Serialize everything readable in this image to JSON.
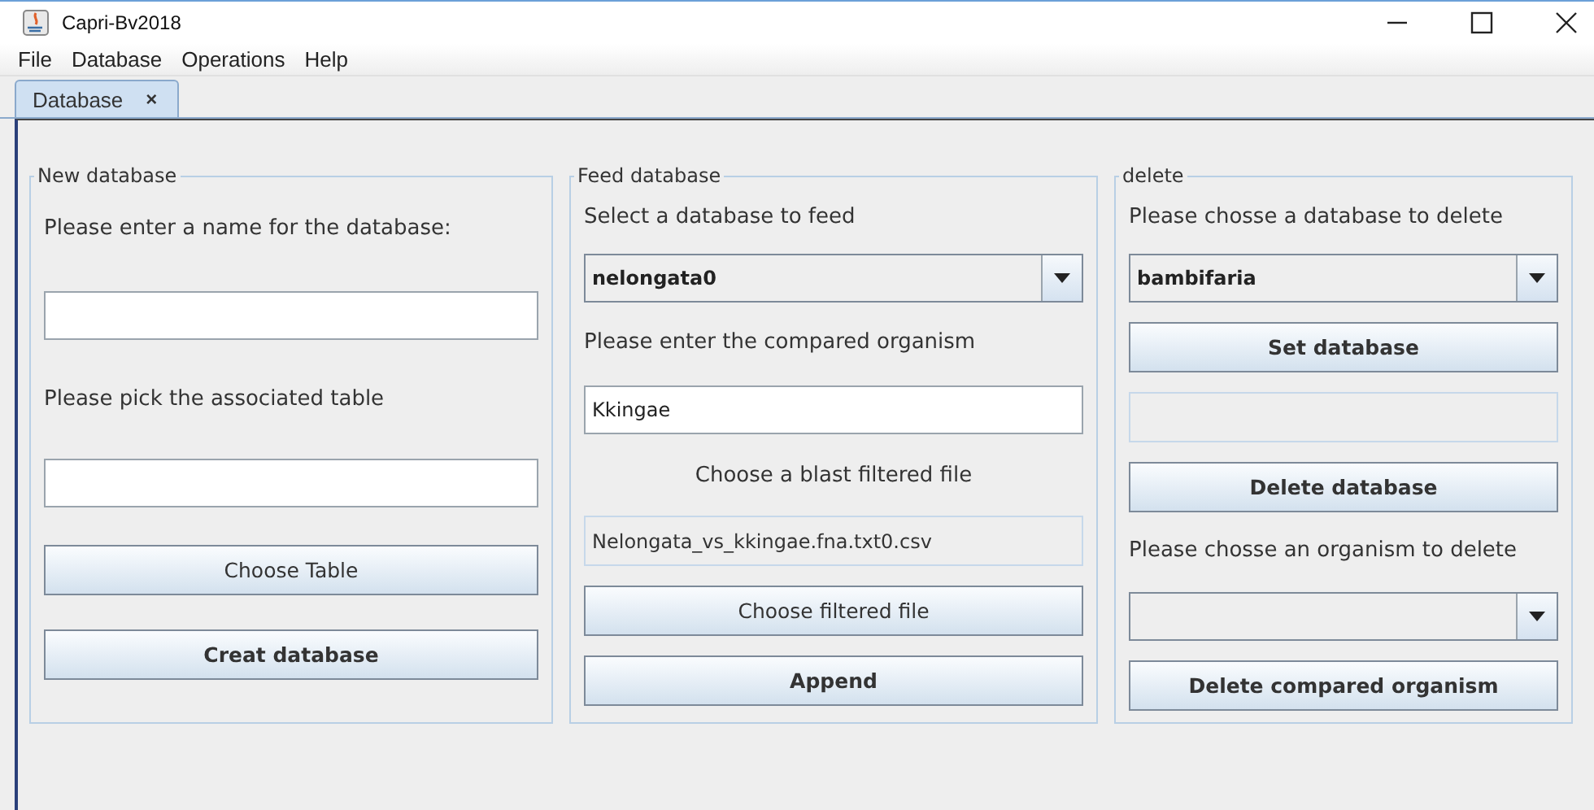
{
  "window": {
    "title": "Capri-Bv2018"
  },
  "menu": [
    "File",
    "Database",
    "Operations",
    "Help"
  ],
  "tabs": [
    {
      "label": "Database",
      "selected": true,
      "close": "×"
    }
  ],
  "panels": [
    {
      "title": "New database",
      "items": [
        {
          "kind": "label",
          "text": "Please enter a name for the database:"
        },
        {
          "kind": "field",
          "value": ""
        },
        {
          "kind": "label",
          "text": "Please pick the associated table"
        },
        {
          "kind": "field",
          "value": ""
        },
        {
          "kind": "button",
          "text": "Choose Table",
          "bold": false
        },
        {
          "kind": "button",
          "text": "Creat database",
          "bold": true
        }
      ]
    },
    {
      "title": "Feed database",
      "items": [
        {
          "kind": "label",
          "text": "Select a database to feed"
        },
        {
          "kind": "combo",
          "value": "nelongata0"
        },
        {
          "kind": "label",
          "text": "Please enter the compared organism"
        },
        {
          "kind": "field",
          "value": "Kkingae"
        },
        {
          "kind": "label_center",
          "text": "Choose a blast filtered file"
        },
        {
          "kind": "readonly",
          "value": "Nelongata_vs_kkingae.fna.txt0.csv"
        },
        {
          "kind": "button",
          "text": "Choose filtered file",
          "bold": false
        },
        {
          "kind": "button",
          "text": "Append",
          "bold": true
        }
      ]
    },
    {
      "title": "delete",
      "items": [
        {
          "kind": "label",
          "text": "Please chosse a database to delete"
        },
        {
          "kind": "combo",
          "value": "bambifaria"
        },
        {
          "kind": "button",
          "text": "Set database",
          "bold": true
        },
        {
          "kind": "readonly",
          "value": ""
        },
        {
          "kind": "button",
          "text": "Delete database",
          "bold": true
        },
        {
          "kind": "label",
          "text": "Please chosse an organism to delete"
        },
        {
          "kind": "combo",
          "value": ""
        },
        {
          "kind": "button",
          "text": "Delete compared organism",
          "bold": true
        }
      ]
    }
  ]
}
